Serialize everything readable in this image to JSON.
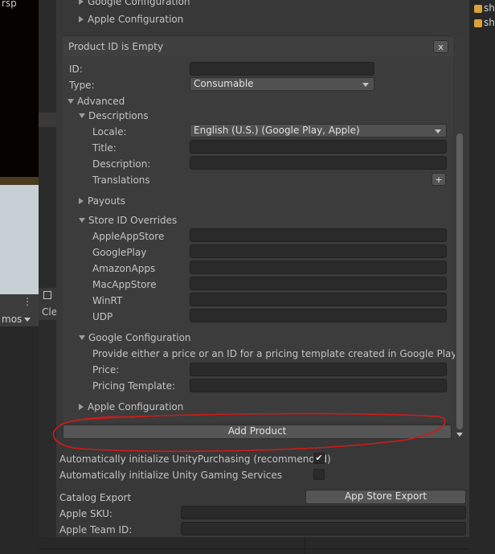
{
  "left_panel": {
    "top_text": "rsp",
    "scene_label": "mos",
    "tab_label": "Cle"
  },
  "right_panel": {
    "item1": "sh",
    "item2": "sh"
  },
  "top_section": {
    "google_configuration": "Google Configuration",
    "apple_configuration": "Apple Configuration"
  },
  "product": {
    "header": "Product ID is Empty",
    "close_label": "x",
    "id_label": "ID:",
    "id_value": "",
    "type_label": "Type:",
    "type_value": "Consumable",
    "advanced_label": "Advanced",
    "descriptions_label": "Descriptions",
    "locale_label": "Locale:",
    "locale_value": "English (U.S.) (Google Play, Apple)",
    "title_label": "Title:",
    "description_label": "Description:",
    "translations_label": "Translations",
    "add_translation_label": "+",
    "payouts_label": "Payouts",
    "store_id_overrides_label": "Store ID Overrides",
    "stores": [
      "AppleAppStore",
      "GooglePlay",
      "AmazonApps",
      "MacAppStore",
      "WinRT",
      "UDP"
    ],
    "google_configuration_label": "Google Configuration",
    "google_hint": "Provide either a price or an ID for a pricing template created in Google Play",
    "price_label": "Price:",
    "pricing_template_label": "Pricing Template:",
    "apple_configuration_label": "Apple Configuration"
  },
  "add_product_label": "Add Product",
  "auto_init_purchasing": {
    "label": "Automatically initialize UnityPurchasing (recommended)",
    "checked": true,
    "check_glyph": "✔"
  },
  "auto_init_gaming": {
    "label": "Automatically initialize Unity Gaming Services",
    "checked": false
  },
  "catalog_export_label": "Catalog Export",
  "app_store_export_label": "App Store Export",
  "apple_sku_label": "Apple SKU:",
  "apple_team_id_label": "Apple Team ID:",
  "colors": {
    "annotation": "#d01a1a",
    "panel_bg": "#383838",
    "button": "#555555"
  }
}
